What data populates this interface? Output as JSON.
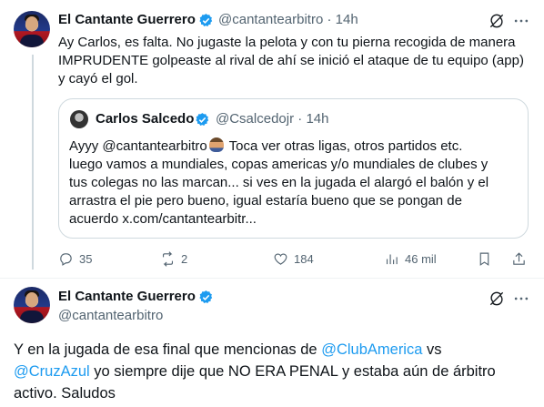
{
  "tweet1": {
    "author_name": "El Cantante Guerrero",
    "handle": "@cantantearbitro",
    "separator": "·",
    "time": "14h",
    "text_lines": [
      "Ay Carlos, es falta. No jugaste la pelota y con tu pierna recogida de manera",
      "IMPRUDENTE golpeaste al rival  de ahí se inició el ataque de tu equipo (app)",
      "y cayó el gol."
    ],
    "quote": {
      "author_name": "Carlos Salcedo",
      "handle": "@Csalcedojr",
      "separator": "·",
      "time": "14h",
      "line1_a": "Ayyy ",
      "line1_mention": "@cantantearbitro",
      "line1_b": " Toca ver otras ligas, otros partidos etc.",
      "lines": [
        "luego vamos a mundiales, copas americas y/o mundiales de clubes y",
        "tus colegas no las marcan... si ves en la jugada el alargó el balón y el",
        "arrastra el pie pero bueno, igual estaría bueno que se pongan de",
        "acuerdo x.com/cantantearbitr..."
      ]
    },
    "actions": {
      "replies": "35",
      "reposts": "2",
      "likes": "184",
      "views": "46 mil"
    }
  },
  "tweet2": {
    "author_name": "El Cantante Guerrero",
    "handle": "@cantantearbitro",
    "line1_a": "Y en la jugada de esa final que mencionas de ",
    "line1_mention": "@ClubAmerica",
    "line1_b": " vs",
    "line2_mention": "@CruzAzul",
    "line2_b": " yo siempre dije que NO ERA PENAL y estaba aún de árbitro",
    "line3": "activo. Saludos"
  },
  "colors": {
    "text": "#0f1419",
    "secondary": "#536471",
    "link": "#1d9bf0",
    "verified": "#1d9bf0",
    "border": "#cfd9de"
  },
  "icons": [
    "verified-badge-icon",
    "grok-icon",
    "more-icon",
    "reply-icon",
    "repost-icon",
    "like-icon",
    "views-icon"
  ]
}
